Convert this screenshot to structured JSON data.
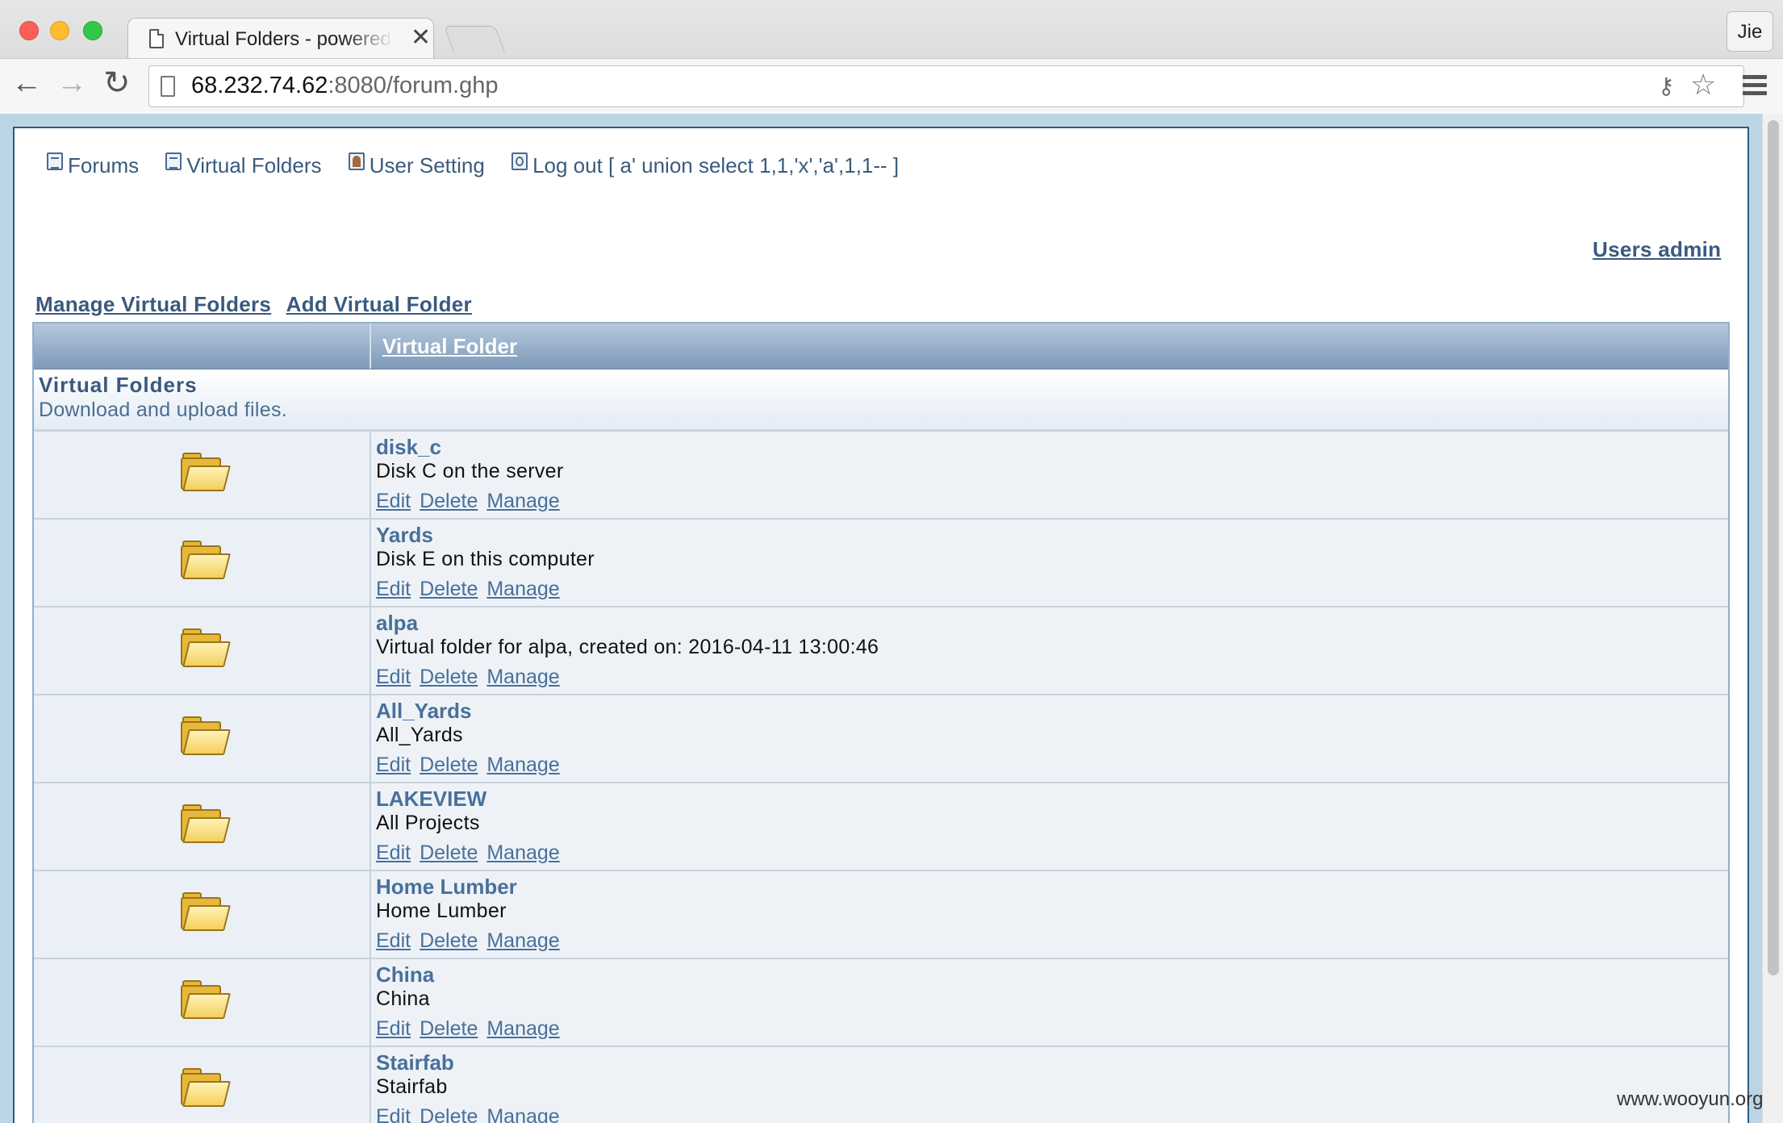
{
  "browser": {
    "tab_title": "Virtual Folders - powered b",
    "tab_close": "✕",
    "profile": "Jie",
    "url_host": "68.232.74.62",
    "url_rest": ":8080/forum.ghp",
    "nav_glyphs": {
      "back": "←",
      "forward": "→",
      "reload": "↻",
      "key": "⚷",
      "star": "☆"
    }
  },
  "nav": {
    "forums": "Forums",
    "virtual_folders": "Virtual Folders",
    "user_setting": "User Setting",
    "logout": "Log out [ a' union select 1,1,'x','a',1,1-- ]"
  },
  "users_admin": "Users admin",
  "subnav": {
    "manage": "Manage Virtual Folders",
    "add": "Add Virtual Folder"
  },
  "table": {
    "header": "Virtual Folder",
    "category_title": "Virtual Folders",
    "category_desc": "Download and upload files.",
    "action_labels": {
      "edit": "Edit",
      "delete": "Delete",
      "manage": "Manage"
    },
    "folders": [
      {
        "name": "disk_c",
        "desc": "Disk C on the server"
      },
      {
        "name": "Yards",
        "desc": "Disk E on this computer"
      },
      {
        "name": "alpa",
        "desc": "Virtual folder for alpa, created on: 2016-04-11 13:00:46"
      },
      {
        "name": "All_Yards",
        "desc": "All_Yards"
      },
      {
        "name": "LAKEVIEW",
        "desc": "All Projects"
      },
      {
        "name": "Home Lumber",
        "desc": "Home Lumber"
      },
      {
        "name": "China",
        "desc": "China"
      },
      {
        "name": "Stairfab",
        "desc": "Stairfab"
      }
    ]
  },
  "watermark": "www.wooyun.org"
}
